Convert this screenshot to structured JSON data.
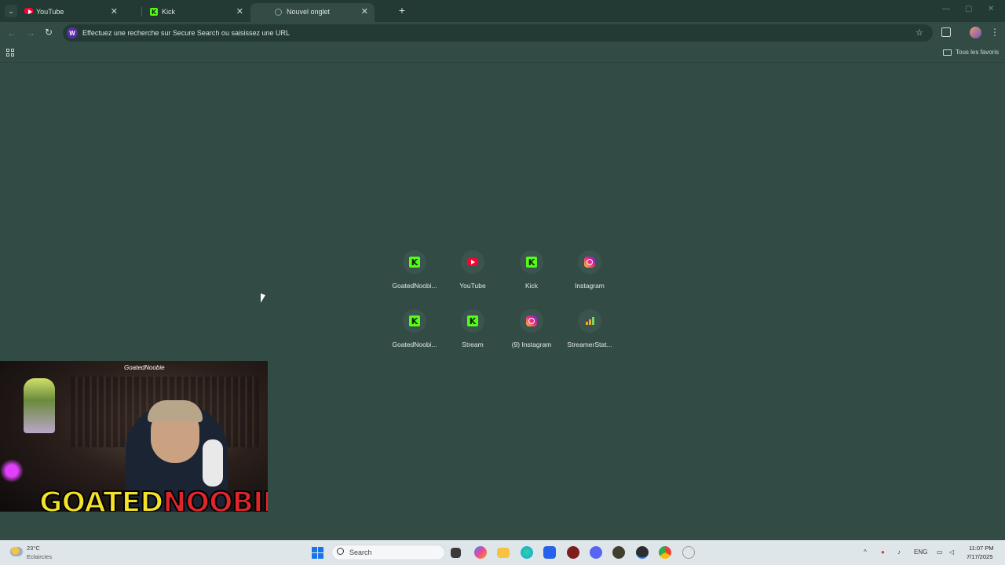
{
  "browser": {
    "tabs": [
      {
        "title": "YouTube",
        "icon": "youtube-icon",
        "active": false
      },
      {
        "title": "Kick",
        "icon": "kick-icon",
        "active": false
      },
      {
        "title": "Nouvel onglet",
        "icon": "globe-icon",
        "active": true
      }
    ],
    "new_tab_symbol": "+",
    "close_symbol": "✕",
    "omnibox_placeholder": "Effectuez une recherche sur Secure Search ou saisissez une URL",
    "search_engine_logo": "W",
    "bookmarks_all_label": "Tous les favoris"
  },
  "shortcuts": [
    {
      "label": "GoatedNoobi...",
      "icon": "kick"
    },
    {
      "label": "YouTube",
      "icon": "youtube"
    },
    {
      "label": "Kick",
      "icon": "kick"
    },
    {
      "label": "Instagram",
      "icon": "instagram"
    },
    {
      "label": "GoatedNoobi...",
      "icon": "kick"
    },
    {
      "label": "Stream",
      "icon": "kick"
    },
    {
      "label": "(9) Instagram",
      "icon": "instagram"
    },
    {
      "label": "StreamerStat...",
      "icon": "stats"
    }
  ],
  "webcam": {
    "handle": "GoatedNoobie",
    "brand_part1": "GOATED",
    "brand_part2": "NOOBIE"
  },
  "taskbar": {
    "weather_temp": "23°C",
    "weather_desc": "Eclaircies",
    "search_label": "Search",
    "language": "ENG",
    "time": "11:07 PM",
    "date": "7/17/2025"
  },
  "colors": {
    "background": "#324b44",
    "tabstrip": "#223a33",
    "kick_green": "#53fc18",
    "youtube_red": "#ff0033"
  }
}
